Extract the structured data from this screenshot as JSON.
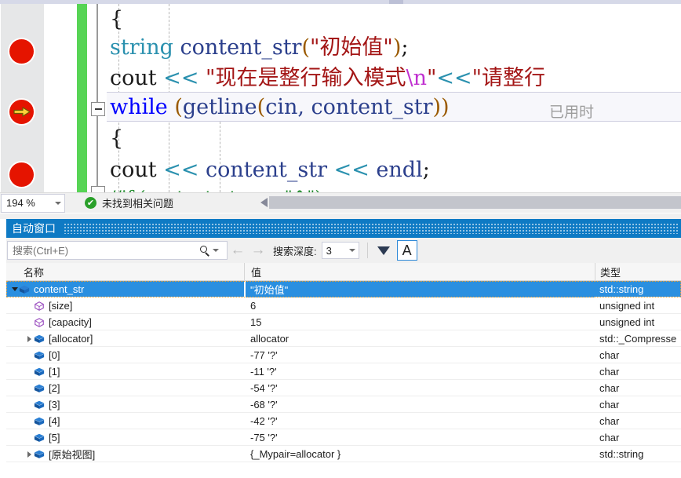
{
  "editor": {
    "code_lines": [
      {
        "id": "l1",
        "tokens": [
          {
            "t": "    {",
            "c": "tok-plain"
          }
        ]
      },
      {
        "id": "l2",
        "tokens": [
          {
            "t": "        ",
            "c": "tok-plain"
          },
          {
            "t": "string",
            "c": "tok-type"
          },
          {
            "t": " content_str",
            "c": "tok-ident"
          },
          {
            "t": "(",
            "c": "tok-paren"
          },
          {
            "t": "\"初始值\"",
            "c": "tok-str"
          },
          {
            "t": ")",
            "c": "tok-paren"
          },
          {
            "t": ";",
            "c": "tok-plain"
          }
        ]
      },
      {
        "id": "l3",
        "tokens": [
          {
            "t": "        cout ",
            "c": "tok-plain"
          },
          {
            "t": "<<",
            "c": "tok-op-t"
          },
          {
            "t": " \"现在是整行输入模式",
            "c": "tok-str"
          },
          {
            "t": "\\n",
            "c": "tok-esc"
          },
          {
            "t": "\"",
            "c": "tok-str"
          },
          {
            "t": "<<",
            "c": "tok-op-t"
          },
          {
            "t": "\"请整行",
            "c": "tok-str"
          }
        ]
      },
      {
        "id": "l4",
        "tokens": [
          {
            "t": "        ",
            "c": "tok-plain"
          },
          {
            "t": "while",
            "c": "tok-kw"
          },
          {
            "t": " ",
            "c": "tok-plain"
          },
          {
            "t": "(",
            "c": "tok-paren"
          },
          {
            "t": "getline",
            "c": "tok-ident"
          },
          {
            "t": "(",
            "c": "tok-paren"
          },
          {
            "t": "cin",
            "c": "tok-ident"
          },
          {
            "t": ",  content_str",
            "c": "tok-ident"
          },
          {
            "t": "))",
            "c": "tok-paren"
          }
        ]
      },
      {
        "id": "l5",
        "tokens": [
          {
            "t": "        {",
            "c": "tok-plain"
          }
        ]
      },
      {
        "id": "l6",
        "tokens": [
          {
            "t": "            cout ",
            "c": "tok-plain"
          },
          {
            "t": "<<",
            "c": "tok-op-t"
          },
          {
            "t": " content_str ",
            "c": "tok-ident"
          },
          {
            "t": "<<",
            "c": "tok-op-t"
          },
          {
            "t": " ",
            "c": "tok-plain"
          },
          {
            "t": "endl",
            "c": "tok-ident"
          },
          {
            "t": ";",
            "c": "tok-plain"
          }
        ]
      },
      {
        "id": "l7",
        "tokens": [
          {
            "t": "             //if (content_str == \"^\")",
            "c": "tok-cmt"
          }
        ]
      }
    ],
    "codelens_hint": "已用时",
    "status": {
      "zoom_level": "194 %",
      "issues_text": "未找到相关问题",
      "check_glyph": "✔"
    }
  },
  "autos": {
    "title": "自动窗口",
    "toolbar": {
      "search_placeholder": "搜索(Ctrl+E)",
      "search_value": "",
      "back_glyph": "←",
      "forward_glyph": "→",
      "depth_label": "搜索深度:",
      "depth_value": "3",
      "alpha_label": "A"
    },
    "columns": {
      "name": "名称",
      "value": "值",
      "type": "类型"
    },
    "rows": [
      {
        "indent": 0,
        "twisty": "down",
        "icon": "object",
        "name": "content_str",
        "value": "\"初始值\"",
        "type": "std::string",
        "selected": true
      },
      {
        "indent": 1,
        "twisty": "none",
        "icon": "field",
        "name": "[size]",
        "value": "6",
        "type": "unsigned int",
        "selected": false
      },
      {
        "indent": 1,
        "twisty": "none",
        "icon": "field",
        "name": "[capacity]",
        "value": "15",
        "type": "unsigned int",
        "selected": false
      },
      {
        "indent": 1,
        "twisty": "right",
        "icon": "object",
        "name": "[allocator]",
        "value": "allocator",
        "type": "std::_Compresse",
        "selected": false
      },
      {
        "indent": 1,
        "twisty": "none",
        "icon": "object",
        "name": "[0]",
        "value": "-77 '?'",
        "type": "char",
        "selected": false
      },
      {
        "indent": 1,
        "twisty": "none",
        "icon": "object",
        "name": "[1]",
        "value": "-11 '?'",
        "type": "char",
        "selected": false
      },
      {
        "indent": 1,
        "twisty": "none",
        "icon": "object",
        "name": "[2]",
        "value": "-54 '?'",
        "type": "char",
        "selected": false
      },
      {
        "indent": 1,
        "twisty": "none",
        "icon": "object",
        "name": "[3]",
        "value": "-68 '?'",
        "type": "char",
        "selected": false
      },
      {
        "indent": 1,
        "twisty": "none",
        "icon": "object",
        "name": "[4]",
        "value": "-42 '?'",
        "type": "char",
        "selected": false
      },
      {
        "indent": 1,
        "twisty": "none",
        "icon": "object",
        "name": "[5]",
        "value": "-75 '?'",
        "type": "char",
        "selected": false
      },
      {
        "indent": 1,
        "twisty": "right",
        "icon": "object",
        "name": "[原始视图]",
        "value": "{_Mypair=allocator }",
        "type": "std::string",
        "selected": false
      }
    ]
  },
  "colors": {
    "accent_blue": "#2a8fe0",
    "title_blue": "#0e7ac4",
    "breakpoint_red": "#e51400",
    "change_green": "#57d455",
    "string_red": "#a31515",
    "keyword_blue": "#0000ff",
    "comment_green": "#1f8a2b"
  }
}
